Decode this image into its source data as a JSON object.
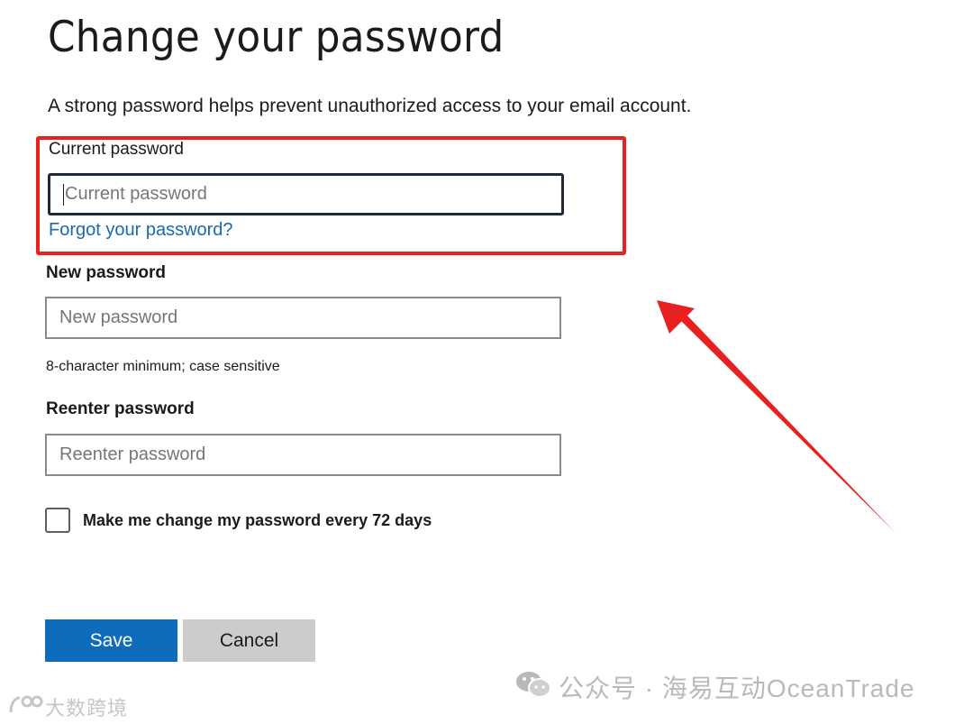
{
  "page": {
    "title": "Change your password",
    "intro": "A strong password helps prevent unauthorized access to your email account."
  },
  "current_password": {
    "label": "Current password",
    "placeholder": "Current password",
    "forgot_link": "Forgot your password?"
  },
  "new_password": {
    "label": "New password",
    "placeholder": "New password",
    "hint": "8-character minimum; case sensitive"
  },
  "reenter_password": {
    "label": "Reenter password",
    "placeholder": "Reenter password"
  },
  "expiry_option": {
    "label": "Make me change my password every 72 days",
    "checked": false
  },
  "buttons": {
    "save": "Save",
    "cancel": "Cancel"
  },
  "annotation": {
    "highlight_color": "#e8201f",
    "arrow_color": "#e8201f"
  },
  "watermarks": {
    "right": "公众号 · 海易互动OceanTrade",
    "left": "大数跨境"
  },
  "colors": {
    "primary": "#0f6cbd",
    "link": "#1a6aa8",
    "secondary_button": "#cccccc"
  }
}
